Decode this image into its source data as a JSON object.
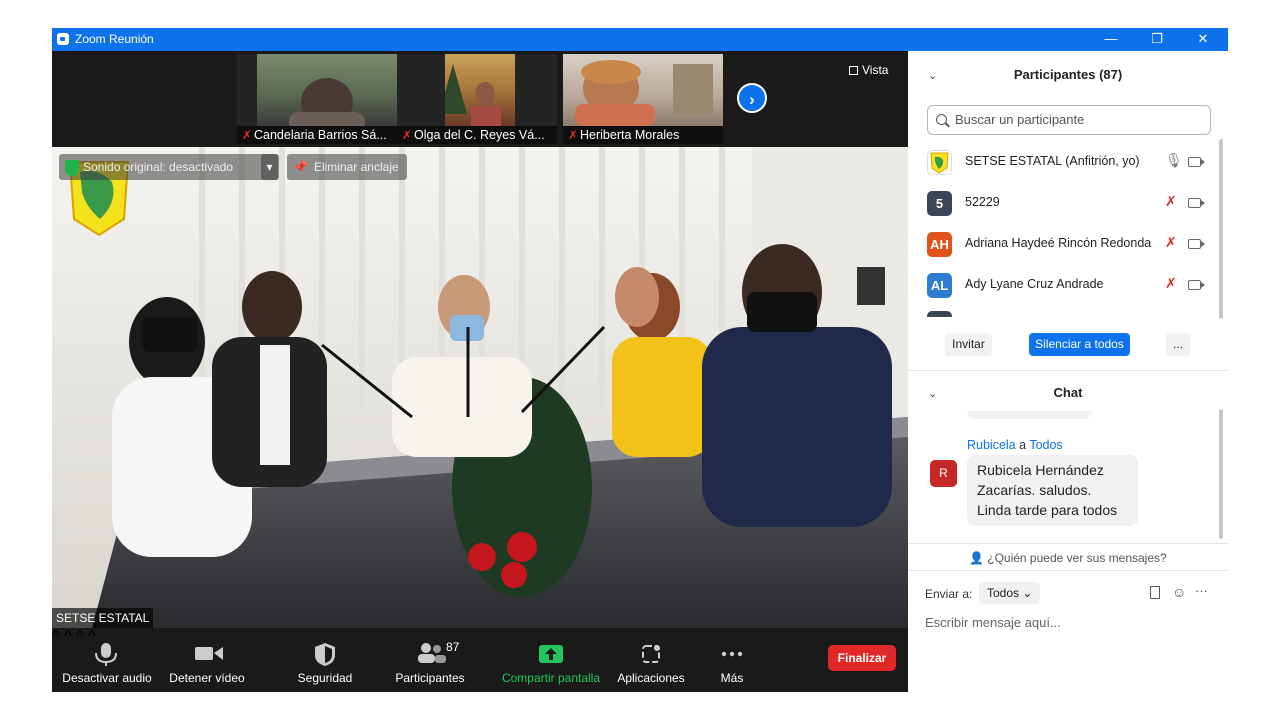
{
  "window": {
    "title": "Zoom Reunión",
    "minimize": "—",
    "restore": "❐",
    "close": "✕"
  },
  "thumbnails": [
    {
      "name": "Candelaria Barrios Sá..."
    },
    {
      "name": "Olga del C. Reyes Vá..."
    },
    {
      "name": "Heriberta Morales"
    }
  ],
  "view_label": "Vista",
  "next_arrow": "›",
  "original_sound": "Sonido original: desactivado",
  "unpin": "Eliminar anclaje",
  "speaker_name": "SETSE ESTATAL",
  "toolbar": {
    "mute": "Desactivar audio",
    "video": "Detener vídeo",
    "security": "Seguridad",
    "participants": "Participantes",
    "participants_count": "87",
    "share": "Compartir pantalla",
    "apps": "Aplicaciones",
    "more": "Más",
    "end": "Finalizar",
    "caret": "^"
  },
  "participants_panel": {
    "title": "Participantes (87)",
    "search_placeholder": "Buscar un participante",
    "list": [
      {
        "initials": "",
        "name": "SETSE ESTATAL (Anfitrión, yo)",
        "color": "#ffffff"
      },
      {
        "initials": "5",
        "name": "52229",
        "color": "#3a4556"
      },
      {
        "initials": "AH",
        "name": "Adriana Haydeé Rincón Redonda",
        "color": "#e0541c"
      },
      {
        "initials": "AL",
        "name": "Ady Lyane Cruz Andrade",
        "color": "#2d7dd2"
      }
    ],
    "invite": "Invitar",
    "mute_all": "Silenciar a todos",
    "more": "..."
  },
  "chat": {
    "title": "Chat",
    "from": "Rubicela",
    "to_word": "a",
    "to": "Todos",
    "avatar": "R",
    "message_lines": [
      "Rubicela Hernández",
      "Zacarías.  saludos.",
      "Linda tarde para todos"
    ],
    "who_can_see": "¿Quién puede ver sus mensajes?",
    "send_to_label": "Enviar a:",
    "send_to_value": "Todos",
    "input_placeholder": "Escribir mensaje aquí...",
    "more": "···"
  },
  "colors": {
    "zoom_blue": "#0e72ed",
    "end_red": "#e02828",
    "share_green": "#22c55e",
    "muted_red": "#e02828"
  }
}
